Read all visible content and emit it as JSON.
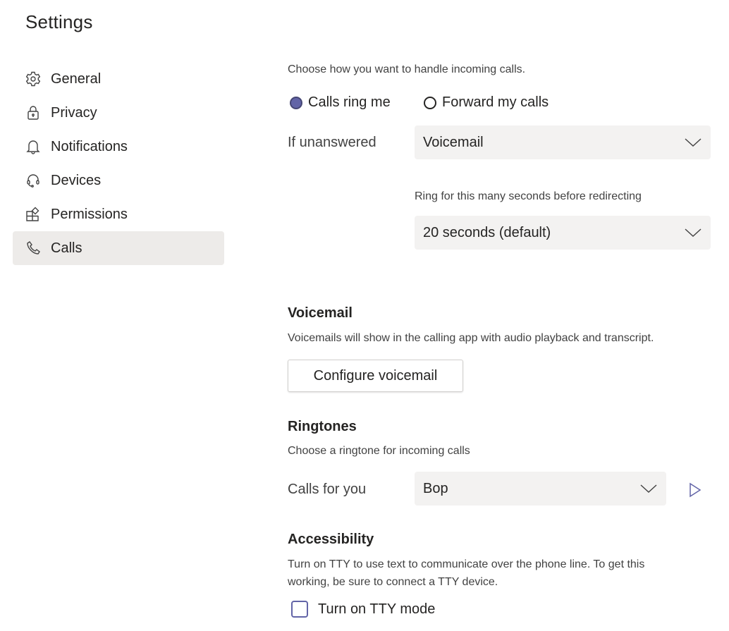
{
  "page": {
    "title": "Settings"
  },
  "sidebar": {
    "items": [
      {
        "label": "General",
        "icon": "gear-icon",
        "active": false
      },
      {
        "label": "Privacy",
        "icon": "lock-icon",
        "active": false
      },
      {
        "label": "Notifications",
        "icon": "bell-icon",
        "active": false
      },
      {
        "label": "Devices",
        "icon": "headset-icon",
        "active": false
      },
      {
        "label": "Permissions",
        "icon": "apps-icon",
        "active": false
      },
      {
        "label": "Calls",
        "icon": "phone-icon",
        "active": true
      }
    ]
  },
  "calls": {
    "handling_description": "Choose how you want to handle incoming calls.",
    "options": [
      {
        "label": "Calls ring me",
        "checked": true
      },
      {
        "label": "Forward my calls",
        "checked": false
      }
    ],
    "if_unanswered_label": "If unanswered",
    "if_unanswered_value": "Voicemail",
    "ring_seconds_label": "Ring for this many seconds before redirecting",
    "ring_seconds_value": "20 seconds (default)"
  },
  "voicemail": {
    "heading": "Voicemail",
    "description": "Voicemails will show in the calling app with audio playback and transcript.",
    "configure_button": "Configure voicemail"
  },
  "ringtones": {
    "heading": "Ringtones",
    "description": "Choose a ringtone for incoming calls",
    "calls_for_you_label": "Calls for you",
    "calls_for_you_value": "Bop"
  },
  "accessibility": {
    "heading": "Accessibility",
    "description_line1": "Turn on TTY to use text to communicate over the phone line. To get this",
    "description_line2": "working, be sure to connect a TTY device.",
    "tty_label": "Turn on TTY mode",
    "tty_checked": false
  },
  "colors": {
    "accent": "#6264a7",
    "selected_nav_bg": "#edebe9",
    "dropdown_bg": "#f3f2f1"
  }
}
